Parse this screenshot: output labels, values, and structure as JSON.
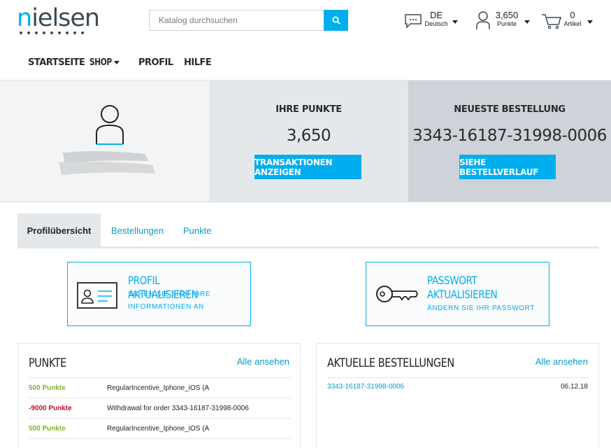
{
  "header": {
    "logo": "nielsen",
    "search": {
      "placeholder": "Katalog durchsuchen"
    },
    "language": {
      "code": "DE",
      "label": "Deutsch"
    },
    "points": {
      "value": "3,650",
      "label": "Punkte"
    },
    "cart": {
      "count": "0",
      "label": "Artikel"
    },
    "icons": {
      "search": "search-icon",
      "chat": "chat-bubble-icon",
      "user": "user-icon",
      "cart": "cart-icon",
      "caret": "caret-down-icon"
    }
  },
  "nav": {
    "items": [
      {
        "label": "STARTSEITE"
      },
      {
        "label": "SHOP"
      },
      {
        "label": "PROFIL"
      },
      {
        "label": "HILFE"
      }
    ]
  },
  "hero": {
    "points": {
      "title": "IHRE PUNKTE",
      "value": "3,650",
      "button": "TRANSAKTIONEN ANZEIGEN"
    },
    "order": {
      "title": "NEUESTE BESTELLUNG",
      "value": "3343-16187-31998-0006",
      "button": "SIEHE BESTELLVERLAUF"
    }
  },
  "tabs": [
    {
      "label": "Profilübersicht"
    },
    {
      "label": "Bestellungen"
    },
    {
      "label": "Punkte"
    }
  ],
  "cards": {
    "profile": {
      "title": "PROFIL AKTUALISIEREN",
      "sub1": "SEHEN SIE SICH IHRE",
      "sub2": "INFORMATIONEN AN"
    },
    "password": {
      "title1": "PASSWORT",
      "title2": "AKTUALISIEREN",
      "sub": "ÄNDERN SIE IHR PASSWORT"
    }
  },
  "points_panel": {
    "title": "PUNKTE",
    "link": "Alle ansehen",
    "rows": [
      {
        "points": "500 Punkte",
        "desc": "RegularIncentive_Iphone_iOS (A",
        "color": "#7ab826"
      },
      {
        "points": "-9000 Punkte",
        "desc": "Withdrawal for order 3343-16187-31998-0006",
        "color": "#c8102e"
      },
      {
        "points": "500 Punkte",
        "desc": "RegularIncentive_Iphone_iOS (A",
        "color": "#7ab826"
      }
    ]
  },
  "orders_panel": {
    "title": "AKTUELLE BESTELLUNGEN",
    "link": "Alle ansehen",
    "rows": [
      {
        "order": "3343-16187-31998-0006",
        "date": "06.12.18"
      }
    ]
  },
  "colors": {
    "accent": "#00aeef",
    "link": "#0a9ac7",
    "positive": "#7ab826",
    "negative": "#c8102e"
  }
}
